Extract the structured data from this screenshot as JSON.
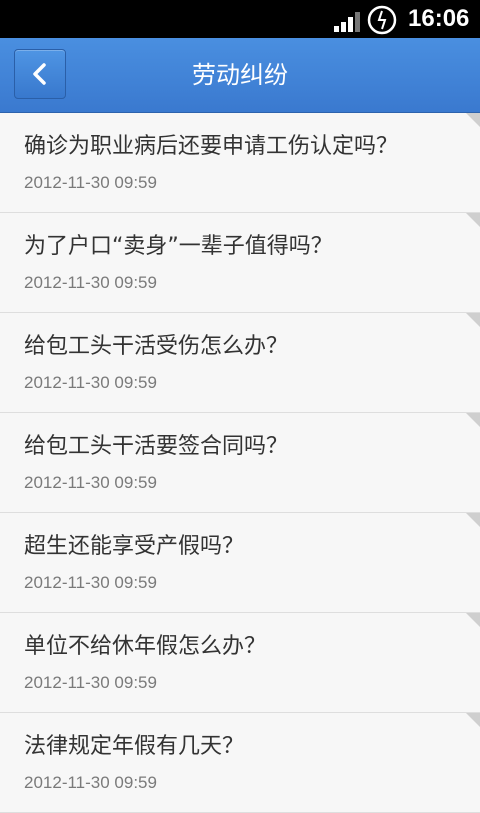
{
  "status_bar": {
    "time": "16:06",
    "icons": [
      "signal-icon",
      "clock-icon"
    ]
  },
  "header": {
    "title": "劳动纠纷",
    "back_icon": "chevron-left-icon"
  },
  "items": [
    {
      "title": "确诊为职业病后还要申请工伤认定吗？",
      "date": "2012-11-30 09:59"
    },
    {
      "title": "为了户口“卖身”一辈子值得吗？",
      "date": "2012-11-30 09:59"
    },
    {
      "title": "给包工头干活受伤怎么办？",
      "date": "2012-11-30 09:59"
    },
    {
      "title": "给包工头干活要签合同吗？",
      "date": "2012-11-30 09:59"
    },
    {
      "title": "超生还能享受产假吗？",
      "date": "2012-11-30 09:59"
    },
    {
      "title": "单位不给休年假怎么办？",
      "date": "2012-11-30 09:59"
    },
    {
      "title": "法律规定年假有几天？",
      "date": "2012-11-30 09:59"
    }
  ],
  "colors": {
    "header_bg": "#3f82d8",
    "status_bg": "#000000",
    "list_bg": "#f7f7f7"
  }
}
